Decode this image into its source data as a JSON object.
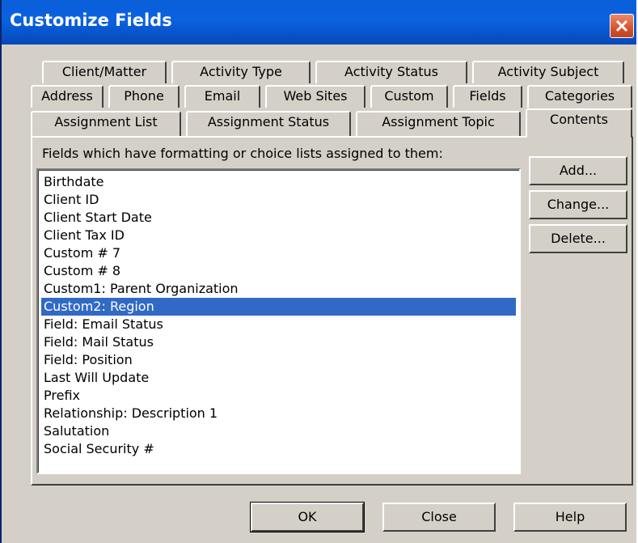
{
  "window": {
    "title": "Customize Fields"
  },
  "tabs_row1": [
    "Client/Matter",
    "Activity Type",
    "Activity Status",
    "Activity Subject"
  ],
  "tabs_row2": [
    "Address",
    "Phone",
    "Email",
    "Web Sites",
    "Custom",
    "Fields",
    "Categories"
  ],
  "tabs_row3": [
    "Assignment List",
    "Assignment Status",
    "Assignment Topic",
    "Contents"
  ],
  "selected_tab": "Contents",
  "panel": {
    "label": "Fields which have formatting or choice lists assigned to them:"
  },
  "list": {
    "items": [
      "Birthdate",
      "Client ID",
      "Client Start Date",
      "Client Tax ID",
      "Custom # 7",
      "Custom # 8",
      "Custom1: Parent Organization",
      "Custom2: Region",
      "Field: Email Status",
      "Field: Mail Status",
      "Field: Position",
      "Last Will Update",
      "Prefix",
      "Relationship: Description 1",
      "Salutation",
      "Social Security #"
    ],
    "selected": "Custom2: Region"
  },
  "side_buttons": {
    "add": "Add...",
    "change": "Change...",
    "delete": "Delete..."
  },
  "footer_buttons": {
    "ok": "OK",
    "close": "Close",
    "help": "Help"
  },
  "colors": {
    "titlebar": "#0b62e0",
    "selection": "#316ac5",
    "face": "#d4d0c8",
    "close": "#d9522d"
  }
}
